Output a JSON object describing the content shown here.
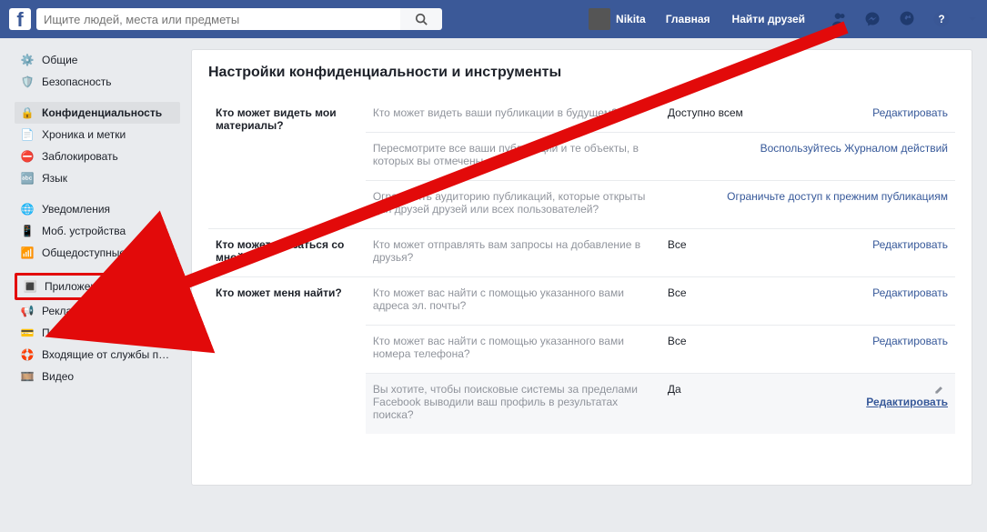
{
  "header": {
    "search_placeholder": "Ищите людей, места или предметы",
    "username": "Nikita",
    "nav_home": "Главная",
    "nav_find_friends": "Найти друзей"
  },
  "sidebar": {
    "groups": [
      {
        "items": [
          {
            "icon": "gear-icon",
            "label": "Общие"
          },
          {
            "icon": "shield-icon",
            "label": "Безопасность"
          }
        ]
      },
      {
        "items": [
          {
            "icon": "lock-icon",
            "label": "Конфиденциальность",
            "active": true
          },
          {
            "icon": "timeline-icon",
            "label": "Хроника и метки"
          },
          {
            "icon": "block-icon",
            "label": "Заблокировать"
          },
          {
            "icon": "language-icon",
            "label": "Язык"
          }
        ]
      },
      {
        "items": [
          {
            "icon": "globe-icon",
            "label": "Уведомления"
          },
          {
            "icon": "mobile-icon",
            "label": "Моб. устройства"
          },
          {
            "icon": "feed-icon",
            "label": "Общедоступные публи…"
          }
        ]
      },
      {
        "items": [
          {
            "icon": "apps-icon",
            "label": "Приложения",
            "highlight": true
          },
          {
            "icon": "ads-icon",
            "label": "Реклама"
          },
          {
            "icon": "card-icon",
            "label": "Платежи"
          },
          {
            "icon": "support-icon",
            "label": "Входящие от службы п…"
          },
          {
            "icon": "video-icon",
            "label": "Видео"
          }
        ]
      }
    ]
  },
  "content": {
    "title": "Настройки конфиденциальности и инструменты",
    "sections": [
      {
        "group_label": "Кто может видеть мои материалы?",
        "rows": [
          {
            "desc": "Кто может видеть ваши публикации в будущем?",
            "value": "Доступно всем",
            "action": "Редактировать"
          },
          {
            "desc": "Пересмотрите все ваши публикации и те объекты, в которых вы отмечены.",
            "value_link": "Воспользуйтесь Журналом действий"
          },
          {
            "desc": "Ограничить аудиторию публикаций, которые открыты для друзей друзей или всех пользователей?",
            "value_link": "Ограничьте доступ к прежним публикациям"
          }
        ]
      },
      {
        "group_label": "Кто может связаться со мной?",
        "rows": [
          {
            "desc": "Кто может отправлять вам запросы на добавление в друзья?",
            "value": "Все",
            "action": "Редактировать"
          }
        ]
      },
      {
        "group_label": "Кто может меня найти?",
        "rows": [
          {
            "desc": "Кто может вас найти с помощью указанного вами адреса эл. почты?",
            "value": "Все",
            "action": "Редактировать"
          },
          {
            "desc": "Кто может вас найти с помощью указанного вами номера телефона?",
            "value": "Все",
            "action": "Редактировать"
          },
          {
            "desc": "Вы хотите, чтобы поисковые системы за пределами Facebook выводили ваш профиль в результатах поиска?",
            "value": "Да",
            "action": "Редактировать",
            "highlighted": true,
            "pencil": true
          }
        ]
      }
    ]
  }
}
